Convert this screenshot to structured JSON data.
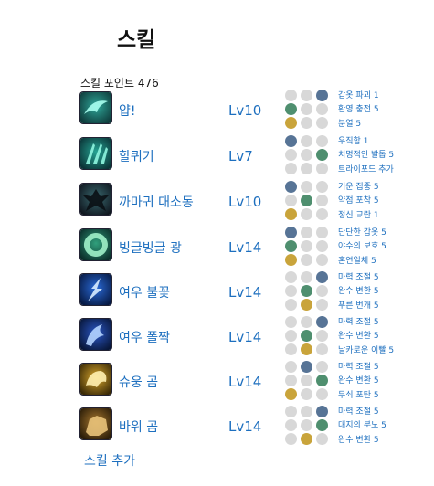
{
  "header": {
    "title": "스킬"
  },
  "skill_points": "스킬 포인트 476",
  "colors": {
    "blue": "#577496",
    "green": "#4f8f6f",
    "yellow": "#c9a43b",
    "empty": "#d8d8d8",
    "link": "#1d6fbf"
  },
  "skills": [
    {
      "name": "얍!",
      "level": "Lv10",
      "icon": "wind-slash-icon",
      "tripods": [
        3,
        1,
        1
      ],
      "mods": [
        "갑옷 파괴 1",
        "환영 충전 5",
        "분열 5"
      ]
    },
    {
      "name": "할퀴기",
      "level": "Lv7",
      "icon": "claw-icon",
      "tripods": [
        1,
        3,
        0
      ],
      "mods": [
        "우직함 1",
        "치명적인 발톱 5",
        "트라이포드 추가"
      ]
    },
    {
      "name": "까마귀 대소동",
      "level": "Lv10",
      "icon": "crow-icon",
      "tripods": [
        1,
        2,
        1
      ],
      "mods": [
        "기운 집중 5",
        "약점 포착 5",
        "정신 교란 1"
      ]
    },
    {
      "name": "빙글빙글 광",
      "level": "Lv14",
      "icon": "spin-icon",
      "tripods": [
        1,
        1,
        1
      ],
      "mods": [
        "단단한 갑옷 5",
        "야수의 보호 5",
        "혼연일체 5"
      ]
    },
    {
      "name": "여우 불꽃",
      "level": "Lv14",
      "icon": "fox-fire-icon",
      "tripods": [
        3,
        2,
        2
      ],
      "mods": [
        "마력 조절 5",
        "완수 변환 5",
        "푸른 번개 5"
      ]
    },
    {
      "name": "여우 폴짝",
      "level": "Lv14",
      "icon": "fox-leap-icon",
      "tripods": [
        3,
        2,
        2
      ],
      "mods": [
        "마력 조절 5",
        "완수 변환 5",
        "날카로운 이빨 5"
      ]
    },
    {
      "name": "슈웅 곰",
      "level": "Lv14",
      "icon": "bear-dash-icon",
      "tripods": [
        2,
        3,
        1
      ],
      "mods": [
        "마력 조절 5",
        "완수 변환 5",
        "무쇠 포탄 5"
      ]
    },
    {
      "name": "바위 곰",
      "level": "Lv14",
      "icon": "rock-bear-icon",
      "tripods": [
        3,
        3,
        2
      ],
      "mods": [
        "마력 조절 5",
        "대지의 분노 5",
        "완수 변환 5"
      ]
    }
  ],
  "add_skill_label": "스킬 추가"
}
